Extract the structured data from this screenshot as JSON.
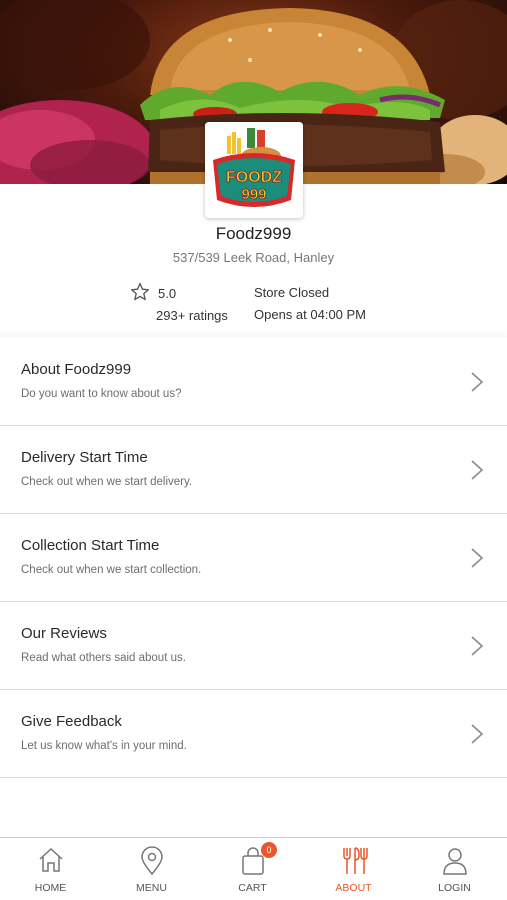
{
  "colors": {
    "accent": "#e8562a",
    "divider": "#dcdcdc",
    "text": "#2a2a2a",
    "muted": "#6e6e6e"
  },
  "store": {
    "logo_text_top": "FOODZ",
    "logo_text_bottom": "999",
    "name": "Foodz999",
    "address": "537/539 Leek Road, Hanley",
    "rating": "5.0",
    "rating_count": "293+ ratings",
    "status": "Store Closed",
    "opens_at": "Opens at 04:00 PM"
  },
  "menu": [
    {
      "title": "About Foodz999",
      "subtitle": "Do you want to know about us?"
    },
    {
      "title": "Delivery Start Time",
      "subtitle": "Check out when we start delivery."
    },
    {
      "title": "Collection Start Time",
      "subtitle": "Check out when we start collection."
    },
    {
      "title": "Our Reviews",
      "subtitle": "Read what others said about us."
    },
    {
      "title": "Give Feedback",
      "subtitle": "Let us know what's in your mind."
    }
  ],
  "tabs": [
    {
      "label": "HOME",
      "icon": "home-icon"
    },
    {
      "label": "MENU",
      "icon": "location-pin-icon"
    },
    {
      "label": "CART",
      "icon": "shopping-bag-icon",
      "badge": "0"
    },
    {
      "label": "ABOUT",
      "icon": "fork-knife-icon",
      "active": true
    },
    {
      "label": "LOGIN",
      "icon": "user-icon"
    }
  ]
}
